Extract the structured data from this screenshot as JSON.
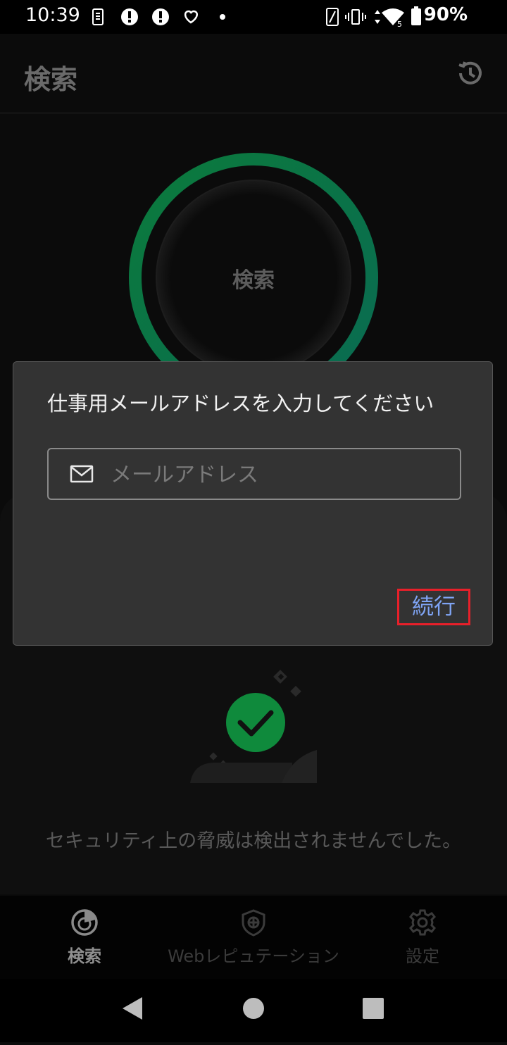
{
  "status_bar": {
    "time": "10:39",
    "battery": "90%",
    "notification_icons": [
      "sim-icon",
      "alert-icon",
      "alert-icon",
      "heart-icon",
      "dot-icon"
    ],
    "system_icons": [
      "screen-rotate-icon",
      "vibrate-icon",
      "data-arrows-icon",
      "wifi-icon",
      "battery-icon"
    ]
  },
  "app_bar": {
    "title": "検索",
    "history_icon": "history-icon"
  },
  "scan": {
    "button_label": "検索",
    "ring_color": "#0f8a4a"
  },
  "dialog": {
    "title": "仕事用メールアドレスを入力してください",
    "email": {
      "value": "",
      "placeholder": "メールアドレス",
      "icon": "mail-icon"
    },
    "continue_label": "続行",
    "continue_color": "#7fa4f4",
    "highlight_color": "#e8202a"
  },
  "status": {
    "message": "セキュリティ上の脅威は検出されませんでした。",
    "check_color": "#0f8a3c"
  },
  "bottom_nav": {
    "items": [
      {
        "label": "検索",
        "icon": "scan-icon",
        "active": true
      },
      {
        "label": "Webレピュテーション",
        "icon": "shield-globe-icon",
        "active": false
      },
      {
        "label": "設定",
        "icon": "gear-icon",
        "active": false
      }
    ]
  },
  "system_nav": {
    "buttons": [
      "back-button",
      "home-button",
      "recents-button"
    ]
  }
}
